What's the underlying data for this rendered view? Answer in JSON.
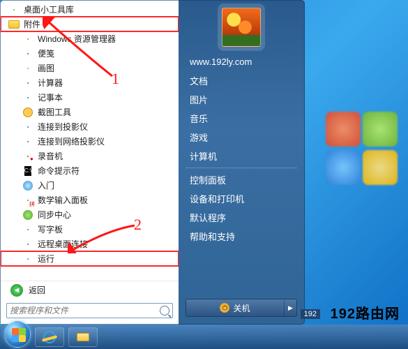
{
  "programs": [
    {
      "id": "gadgets",
      "label": "桌面小工具库",
      "iconClass": "gadget-ic",
      "indent": false
    },
    {
      "id": "accessories",
      "label": "附件",
      "iconClass": "folder-ic",
      "indent": false,
      "highlight": true
    },
    {
      "id": "explorer",
      "label": "Windows 资源管理器",
      "iconClass": "explore-ic",
      "indent": true
    },
    {
      "id": "sticky",
      "label": "便笺",
      "iconClass": "notepad-ic",
      "indent": true
    },
    {
      "id": "paint",
      "label": "画图",
      "iconClass": "paint-ic",
      "indent": true
    },
    {
      "id": "calc",
      "label": "计算器",
      "iconClass": "calc-ic",
      "indent": true
    },
    {
      "id": "notepad",
      "label": "记事本",
      "iconClass": "notepad-ic",
      "indent": true
    },
    {
      "id": "snip",
      "label": "截图工具",
      "iconClass": "snip-ic",
      "indent": true
    },
    {
      "id": "proj",
      "label": "连接到投影仪",
      "iconClass": "proj-ic",
      "indent": true
    },
    {
      "id": "netproj",
      "label": "连接到网络投影仪",
      "iconClass": "proj-ic",
      "indent": true
    },
    {
      "id": "sndrec",
      "label": "录音机",
      "iconClass": "rec-ic",
      "indent": true
    },
    {
      "id": "cmd",
      "label": "命令提示符",
      "iconClass": "cmd-ic",
      "indent": true
    },
    {
      "id": "intro",
      "label": "入门",
      "iconClass": "intro-ic",
      "indent": true
    },
    {
      "id": "ime",
      "label": "数学输入面板",
      "iconClass": "ime-ic",
      "indent": true
    },
    {
      "id": "sync",
      "label": "同步中心",
      "iconClass": "sync-ic",
      "indent": true
    },
    {
      "id": "tablet",
      "label": "写字板",
      "iconClass": "pen-ic",
      "indent": true
    },
    {
      "id": "rdp",
      "label": "远程桌面连接",
      "iconClass": "rdp-ic",
      "indent": true
    },
    {
      "id": "run",
      "label": "运行",
      "iconClass": "run-ic",
      "indent": true,
      "highlight": true
    }
  ],
  "back_label": "返回",
  "search": {
    "placeholder": "搜索程序和文件"
  },
  "right_pane": {
    "username": "www.192ly.com",
    "items_a": [
      "文档",
      "图片",
      "音乐",
      "游戏",
      "计算机"
    ],
    "items_b": [
      "控制面板",
      "设备和打印机",
      "默认程序",
      "帮助和支持"
    ]
  },
  "shutdown": {
    "label": "关机"
  },
  "annotations": {
    "marker1": "1",
    "marker2": "2"
  },
  "watermark": "192路由网",
  "tray_time": "192"
}
